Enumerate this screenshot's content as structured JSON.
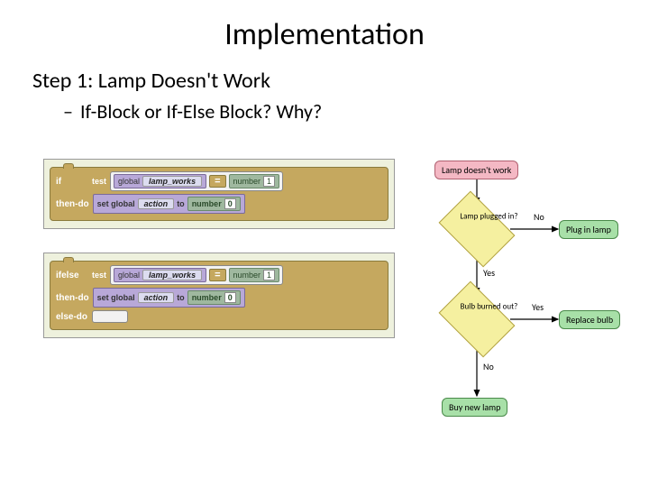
{
  "title": "Implementation",
  "step": "Step 1: Lamp Doesn't Work",
  "sub_prefix": "–",
  "sub": "If-Block or If-Else Block? Why?",
  "block1": {
    "if": "if",
    "test": "test",
    "global": "global",
    "var": "lamp_works",
    "eq": "=",
    "number": "number",
    "val1": "1",
    "thendo": "then-do",
    "setglobal": "set global",
    "actionvar": "action",
    "to": "to",
    "val0": "0"
  },
  "block2": {
    "ifelse": "ifelse",
    "test": "test",
    "global": "global",
    "var": "lamp_works",
    "eq": "=",
    "number": "number",
    "val1": "1",
    "thendo": "then-do",
    "setglobal": "set global",
    "actionvar": "action",
    "to": "to",
    "val0": "0",
    "elsedo": "else-do"
  },
  "flow": {
    "start": "Lamp doesn't work",
    "d1": "Lamp plugged in?",
    "d1_no": "No",
    "d1_yes": "Yes",
    "a1": "Plug in lamp",
    "d2": "Bulb burned out?",
    "d2_yes": "Yes",
    "d2_no": "No",
    "a2": "Replace bulb",
    "end": "Buy new lamp"
  },
  "chart_data": {
    "type": "flowchart",
    "nodes": [
      {
        "id": "start",
        "type": "terminator",
        "label": "Lamp doesn't work"
      },
      {
        "id": "d1",
        "type": "decision",
        "label": "Lamp plugged in?"
      },
      {
        "id": "a1",
        "type": "process",
        "label": "Plug in lamp"
      },
      {
        "id": "d2",
        "type": "decision",
        "label": "Bulb burned out?"
      },
      {
        "id": "a2",
        "type": "process",
        "label": "Replace bulb"
      },
      {
        "id": "end",
        "type": "process",
        "label": "Buy new lamp"
      }
    ],
    "edges": [
      {
        "from": "start",
        "to": "d1",
        "label": ""
      },
      {
        "from": "d1",
        "to": "a1",
        "label": "No"
      },
      {
        "from": "d1",
        "to": "d2",
        "label": "Yes"
      },
      {
        "from": "d2",
        "to": "a2",
        "label": "Yes"
      },
      {
        "from": "d2",
        "to": "end",
        "label": "No"
      }
    ]
  }
}
